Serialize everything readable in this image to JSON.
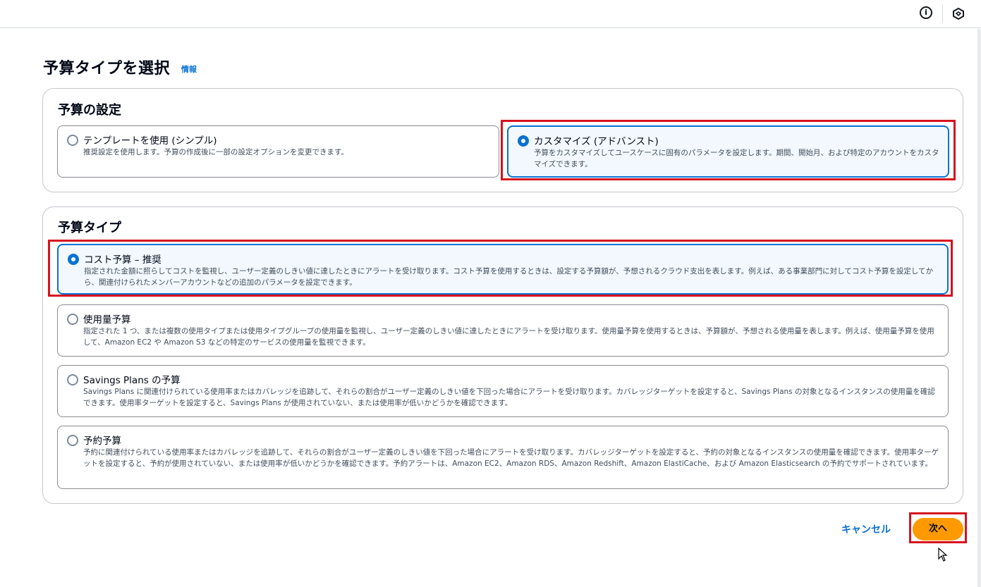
{
  "header": {
    "info_icon_glyph": "i"
  },
  "page": {
    "title": "予算タイプを選択",
    "info_link": "情報"
  },
  "budget_setup": {
    "heading": "予算の設定",
    "options": [
      {
        "label": "テンプレートを使用 (シンプル)",
        "description": "推奨設定を使用します。予算の作成後に一部の設定オプションを変更できます。",
        "selected": false
      },
      {
        "label": "カスタマイズ (アドバンスト)",
        "description": "予算をカスタマイズしてユースケースに固有のパラメータを設定します。期間、開始月、および特定のアカウントをカスタマイズできます。",
        "selected": true
      }
    ]
  },
  "budget_type": {
    "heading": "予算タイプ",
    "options": [
      {
        "label": "コスト予算 – 推奨",
        "description": "指定された金額に照らしてコストを監視し、ユーザー定義のしきい値に達したときにアラートを受け取ります。コスト予算を使用するときは、設定する予算額が、予想されるクラウド支出を表します。例えば、ある事業部門に対してコスト予算を設定してから、関連付けられたメンバーアカウントなどの追加のパラメータを設定できます。",
        "selected": true
      },
      {
        "label": "使用量予算",
        "description": "指定された 1 つ、または複数の使用タイプまたは使用タイプグループの使用量を監視し、ユーザー定義のしきい値に達したときにアラートを受け取ります。使用量予算を使用するときは、予算額が、予想される使用量を表します。例えば、使用量予算を使用して、Amazon EC2 や Amazon S3 などの特定のサービスの使用量を監視できます。",
        "selected": false
      },
      {
        "label": "Savings Plans の予算",
        "description": "Savings Plans に関連付けられている使用率またはカバレッジを追跡して、それらの割合がユーザー定義のしきい値を下回った場合にアラートを受け取ります。カバレッジターゲットを設定すると、Savings Plans の対象となるインスタンスの使用量を確認できます。使用率ターゲットを設定すると、Savings Plans が使用されていない、または使用率が低いかどうかを確認できます。",
        "selected": false
      },
      {
        "label": "予約予算",
        "description": "予約に関連付けられている使用率またはカバレッジを追跡して、それらの割合がユーザー定義のしきい値を下回った場合にアラートを受け取ります。カバレッジターゲットを設定すると、予約の対象となるインスタンスの使用量を確認できます。使用率ターゲットを設定すると、予約が使用されていない、または使用率が低いかどうかを確認できます。予約アラートは、Amazon EC2、Amazon RDS、Amazon Redshift、Amazon ElastiCache、および Amazon Elasticsearch の予約でサポートされています。",
        "selected": false
      }
    ]
  },
  "footer": {
    "cancel_label": "キャンセル",
    "next_label": "次へ"
  },
  "colors": {
    "accent": "#0972d3",
    "primary_button": "#ff9900",
    "highlight": "#d6121d"
  }
}
